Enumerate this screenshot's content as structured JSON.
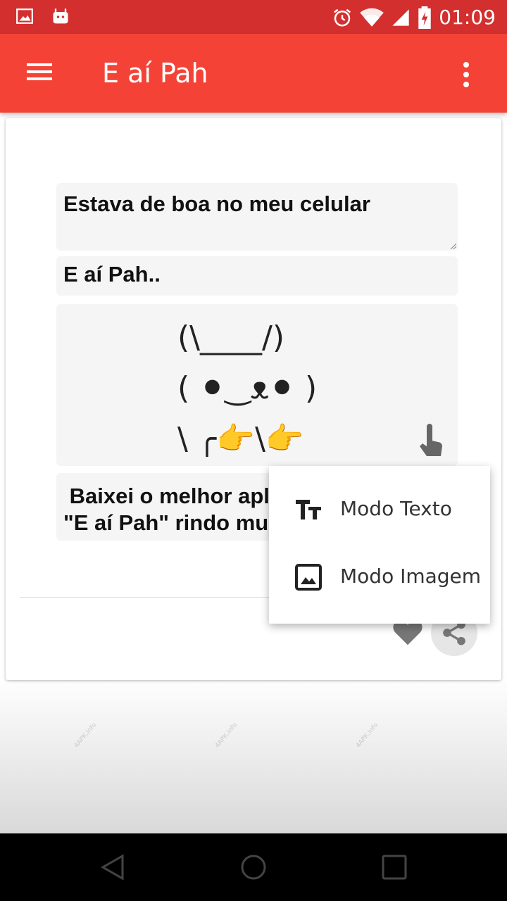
{
  "status_bar": {
    "time": "01:09",
    "icons": [
      "image-icon",
      "android-icon",
      "alarm-icon",
      "wifi-icon",
      "signal-icon",
      "battery-icon"
    ]
  },
  "app_bar": {
    "title": "E aí Pah",
    "menu_icon": "hamburger-menu-icon",
    "more_icon": "more-vert-icon",
    "color": "#f44336"
  },
  "card": {
    "top_text": "Estava de boa no meu celular",
    "mid_text": "E aí Pah..",
    "art_lines": [
      "(\\____/)",
      "( ⚫‿ᴥ⚫ )",
      "\\ ╭👉\\👉"
    ],
    "bottom_text_visible": " Baixei o melhor apli\n\"E aí Pah\" rindo muit",
    "touch_icon": "touch-hand-icon",
    "favorite_icon": "heart-icon",
    "share_icon": "share-icon"
  },
  "popup_menu": {
    "items": [
      {
        "label": "Modo Texto",
        "icon": "text-format-icon"
      },
      {
        "label": "Modo Imagem",
        "icon": "image-icon"
      }
    ]
  },
  "watermark": "4APK.info",
  "nav_bar": {
    "icons": [
      "back-icon",
      "home-icon",
      "recents-icon"
    ]
  }
}
